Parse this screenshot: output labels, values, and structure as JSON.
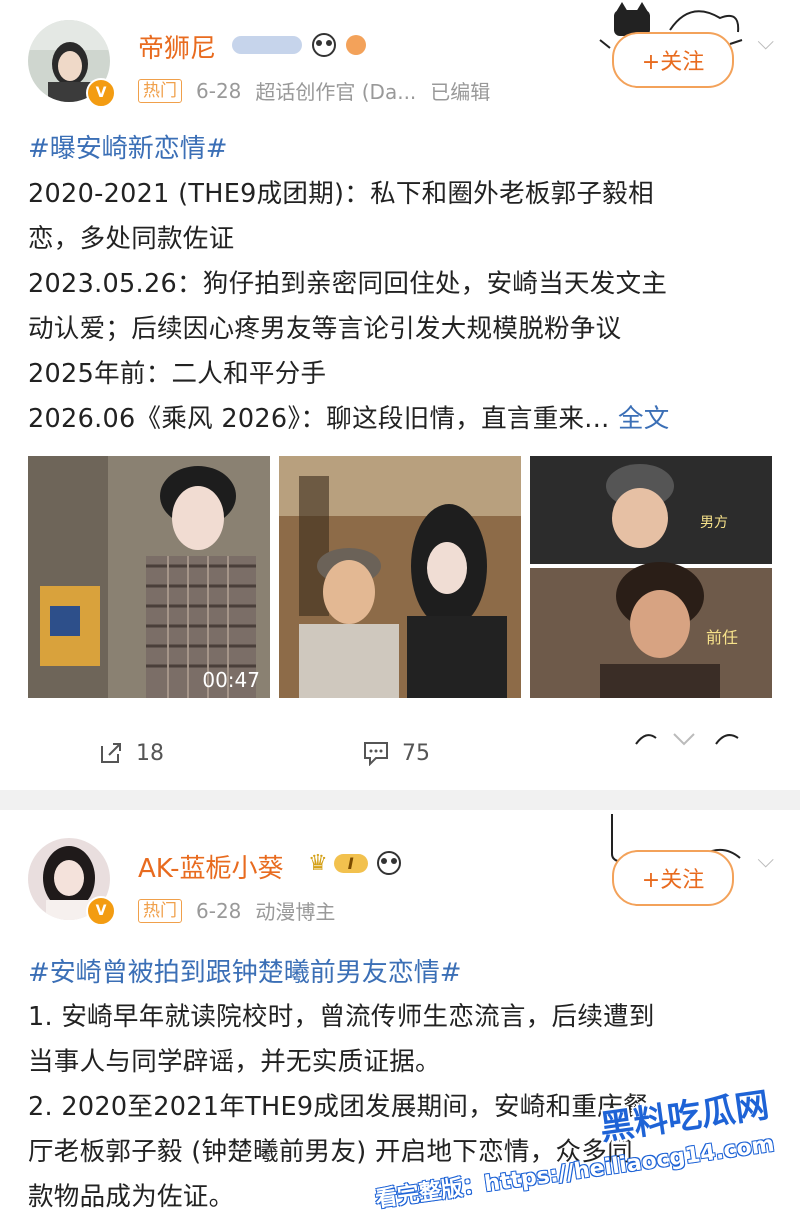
{
  "post1": {
    "username": "帝狮尼",
    "hot_badge": "热门",
    "date": "6-28",
    "role": "超话创作官 (Da...",
    "edited": "已编辑",
    "follow_label": "+关注",
    "topic": "#曝安崎新恋情#",
    "lines": [
      "2020-2021 (THE9成团期)：私下和圈外老板郭子毅相",
      "恋，多处同款佐证",
      "2023.05.26：狗仔拍到亲密同回住处，安崎当天发文主",
      "动认爱；后续因心疼男友等言论引发大规模脱粉争议",
      "2025年前：二人和平分手",
      "2026.06《乘风 2026》：聊这段旧情，直言重来..."
    ],
    "full_text_link": "全文",
    "video_duration": "00:47",
    "image_labels": {
      "man": "男方",
      "ex": "前任"
    },
    "repost_count": "18",
    "comment_count": "75"
  },
  "post2": {
    "username": "AK-蓝栀小葵",
    "level_badge": "I",
    "hot_badge": "热门",
    "date": "6-28",
    "role": "动漫博主",
    "follow_label": "+关注",
    "topic": "#安崎曾被拍到跟钟楚曦前男友恋情#",
    "lines": [
      "1. 安崎早年就读院校时，曾流传师生恋流言，后续遭到",
      "当事人与同学辟谣，并无实质证据。",
      "2. 2020至2021年THE9成团发展期间，安崎和重庆餐",
      "厅老板郭子毅 (钟楚曦前男友) 开启地下恋情，众多同",
      "款物品成为佐证。"
    ]
  },
  "watermark": {
    "line1": "黑料吃瓜网",
    "line2": "看完整版：https://heiliaocg14.com"
  },
  "colors": {
    "username": "#e86b1f",
    "topic": "#3b6fb6",
    "meta": "#999999",
    "watermark": "#1e63d6"
  }
}
